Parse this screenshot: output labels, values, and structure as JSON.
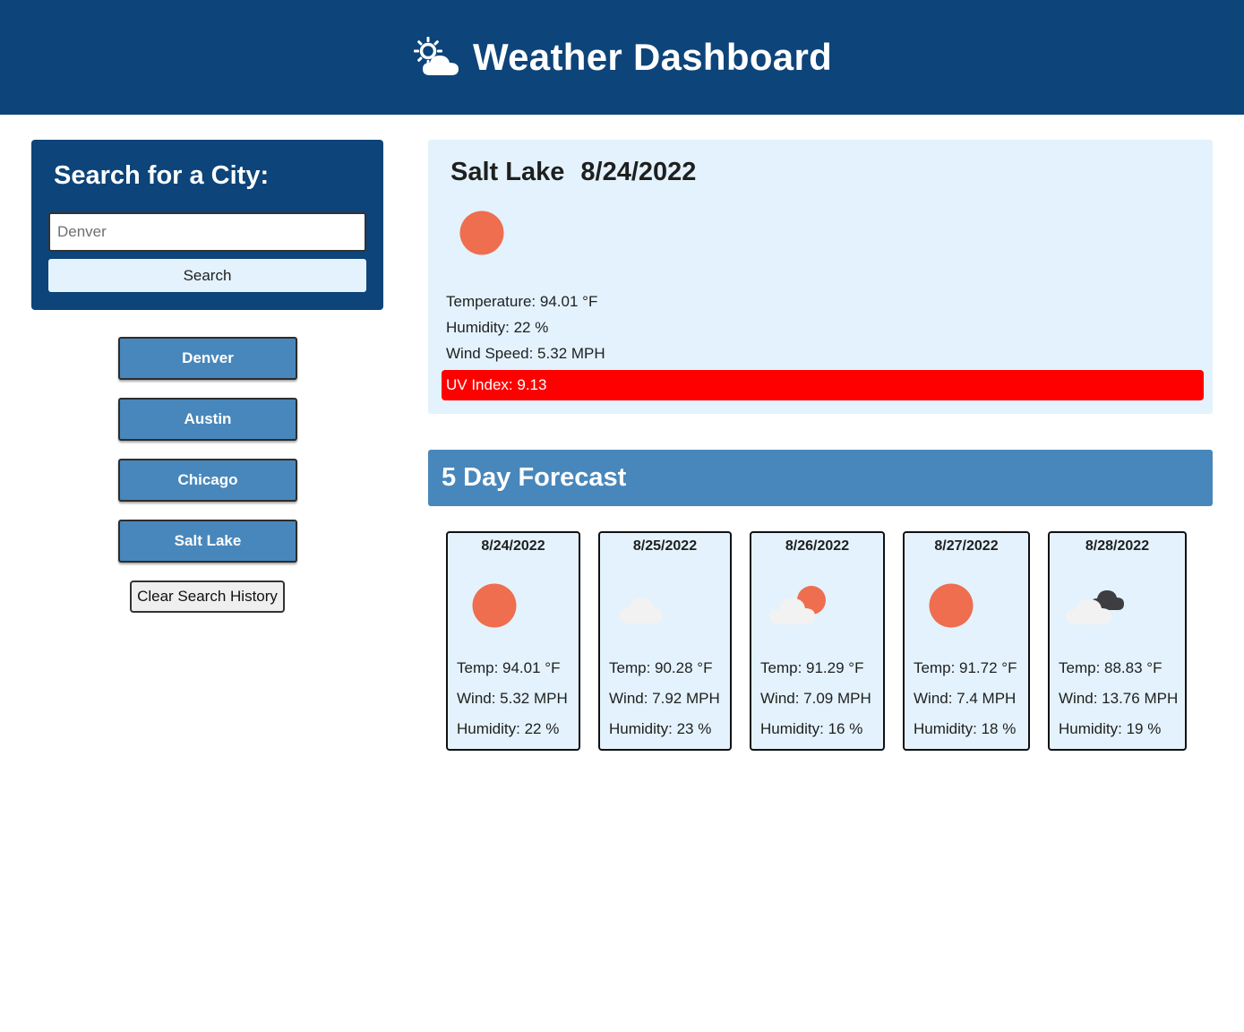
{
  "header": {
    "title": "Weather Dashboard",
    "icon": "cloud-sun-icon"
  },
  "search": {
    "heading": "Search for a City:",
    "placeholder": "Denver",
    "button_label": "Search"
  },
  "history": {
    "cities": [
      "Denver",
      "Austin",
      "Chicago",
      "Salt Lake"
    ],
    "clear_label": "Clear Search History"
  },
  "current": {
    "city": "Salt Lake",
    "date": "8/24/2022",
    "icon": "sun-icon",
    "temperature": "Temperature: 94.01 °F",
    "humidity": "Humidity: 22 %",
    "wind": "Wind Speed: 5.32 MPH",
    "uv": "UV Index: 9.13",
    "uv_color": "#ff0000"
  },
  "forecast": {
    "heading": "5 Day Forecast",
    "days": [
      {
        "date": "8/24/2022",
        "icon": "sun-icon",
        "temp": "Temp: 94.01 °F",
        "wind": "Wind: 5.32 MPH",
        "humidity": "Humidity: 22 %"
      },
      {
        "date": "8/25/2022",
        "icon": "cloud-icon",
        "temp": "Temp: 90.28 °F",
        "wind": "Wind: 7.92 MPH",
        "humidity": "Humidity: 23 %"
      },
      {
        "date": "8/26/2022",
        "icon": "partly-cloudy-icon",
        "temp": "Temp: 91.29 °F",
        "wind": "Wind: 7.09 MPH",
        "humidity": "Humidity: 16 %"
      },
      {
        "date": "8/27/2022",
        "icon": "sun-icon",
        "temp": "Temp: 91.72 °F",
        "wind": "Wind: 7.4 MPH",
        "humidity": "Humidity: 18 %"
      },
      {
        "date": "8/28/2022",
        "icon": "dark-clouds-icon",
        "temp": "Temp: 88.83 °F",
        "wind": "Wind: 13.76 MPH",
        "humidity": "Humidity: 19 %"
      }
    ]
  },
  "colors": {
    "header_bg": "#0d4479",
    "accent": "#4887bb",
    "panel_bg": "#e3f2fc",
    "sun": "#ee6e4f"
  }
}
